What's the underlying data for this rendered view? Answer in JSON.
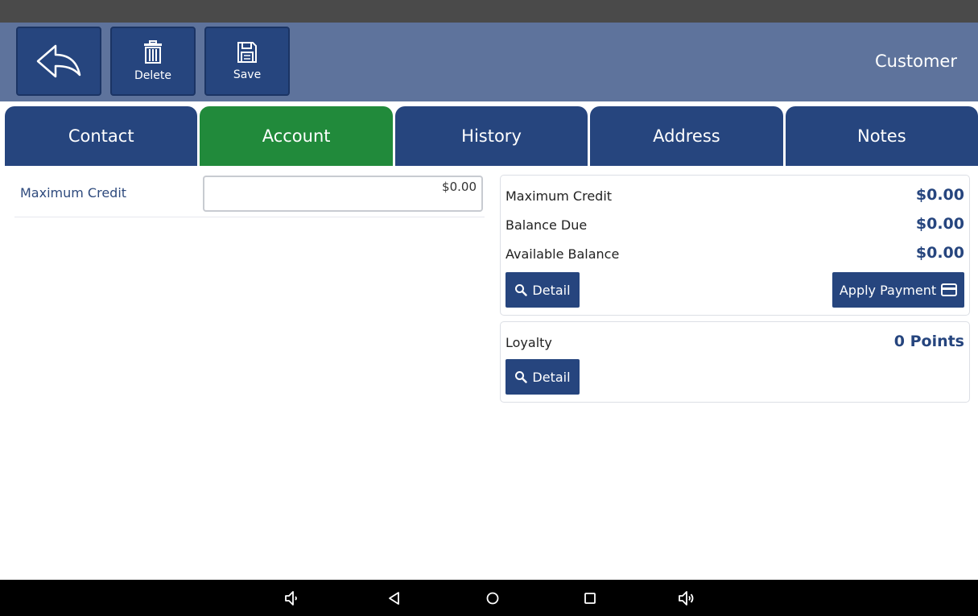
{
  "toolbar": {
    "back_icon": "back-arrow-icon",
    "delete_label": "Delete",
    "delete_icon": "trash-icon",
    "save_label": "Save",
    "save_icon": "floppy-disk-icon",
    "title": "Customer"
  },
  "tabs": [
    {
      "label": "Contact",
      "active": false
    },
    {
      "label": "Account",
      "active": true
    },
    {
      "label": "History",
      "active": false
    },
    {
      "label": "Address",
      "active": false
    },
    {
      "label": "Notes",
      "active": false
    }
  ],
  "colors": {
    "primary": "#26457e",
    "active_tab": "#218a3b",
    "toolbar": "#5e739c"
  },
  "account_form": {
    "max_credit_label": "Maximum Credit",
    "max_credit_value": "$0.00"
  },
  "balance_card": {
    "rows": [
      {
        "label": "Maximum Credit",
        "value": "$0.00"
      },
      {
        "label": "Balance Due",
        "value": "$0.00"
      },
      {
        "label": "Available Balance",
        "value": "$0.00"
      }
    ],
    "detail_label": "Detail",
    "detail_icon": "search-icon",
    "apply_payment_label": "Apply Payment",
    "apply_payment_icon": "credit-card-icon"
  },
  "loyalty_card": {
    "label": "Loyalty",
    "value": "0 Points",
    "detail_label": "Detail",
    "detail_icon": "search-icon"
  },
  "navbar": {
    "icons": [
      "volume-down-icon",
      "nav-back-icon",
      "nav-home-icon",
      "nav-recents-icon",
      "volume-up-icon"
    ]
  }
}
